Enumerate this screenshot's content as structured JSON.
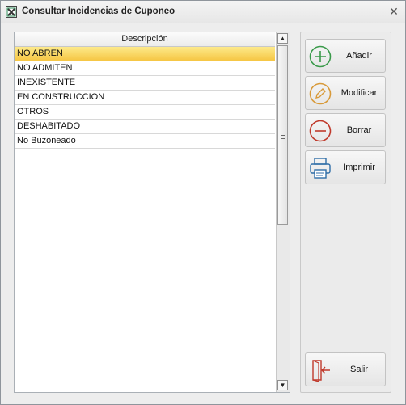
{
  "window": {
    "title": "Consultar Incidencias de Cuponeo",
    "close_glyph": "✕"
  },
  "grid": {
    "column_header": "Descripción",
    "rows": [
      "NO ABREN",
      "NO ADMITEN",
      "INEXISTENTE",
      "EN CONSTRUCCION",
      "OTROS",
      "DESHABITADO",
      "No Buzoneado"
    ],
    "selected_index": 0
  },
  "scrollbar": {
    "up_glyph": "▲",
    "down_glyph": "▼"
  },
  "actions": {
    "add": {
      "label": "Añadir",
      "icon": "plus-circle-icon",
      "color": "#3a9a4a"
    },
    "modify": {
      "label": "Modificar",
      "icon": "pencil-circle-icon",
      "color": "#d89a3a"
    },
    "delete": {
      "label": "Borrar",
      "icon": "minus-circle-icon",
      "color": "#c0392b"
    },
    "print": {
      "label": "Imprimir",
      "icon": "printer-icon",
      "color": "#2f6ea8"
    },
    "exit": {
      "label": "Salir",
      "icon": "exit-door-icon",
      "color": "#c0392b"
    }
  },
  "colors": {
    "selection": "#f6c644",
    "window_bg": "#ededed"
  }
}
